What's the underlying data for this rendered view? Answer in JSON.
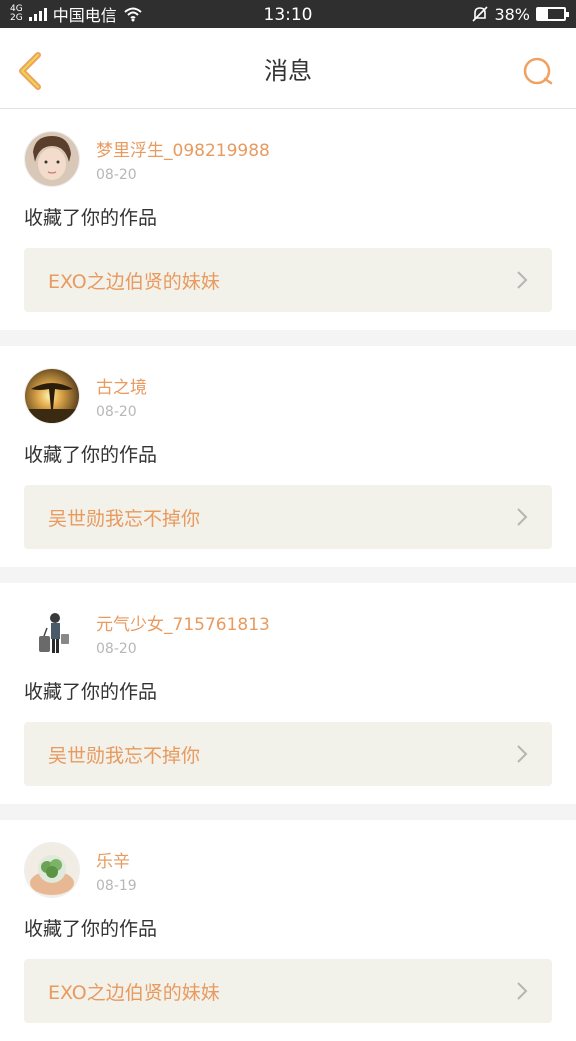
{
  "status_bar": {
    "network_type_top": "4G",
    "network_type_bottom": "2G",
    "carrier": "中国电信",
    "time": "13:10",
    "battery_percent_label": "38%",
    "battery_level": 0.38
  },
  "nav": {
    "title": "消息",
    "back_icon": "chevron-left-icon",
    "search_icon": "search-icon",
    "accent_color": "#f0a162"
  },
  "messages": [
    {
      "username": "梦里浮生_098219988",
      "date": "08-20",
      "action": "收藏了你的作品",
      "work_title": "EXO之边伯贤的妹妹",
      "avatar": "portrait-avatar"
    },
    {
      "username": "古之境",
      "date": "08-20",
      "action": "收藏了你的作品",
      "work_title": "吴世勋我忘不掉你",
      "avatar": "sunset-tree-avatar"
    },
    {
      "username": "元气少女_715761813",
      "date": "08-20",
      "action": "收藏了你的作品",
      "work_title": "吴世勋我忘不掉你",
      "avatar": "figure-with-luggage-avatar"
    },
    {
      "username": "乐辛",
      "date": "08-19",
      "action": "收藏了你的作品",
      "work_title": "EXO之边伯贤的妹妹",
      "avatar": "plant-in-hands-avatar"
    }
  ]
}
